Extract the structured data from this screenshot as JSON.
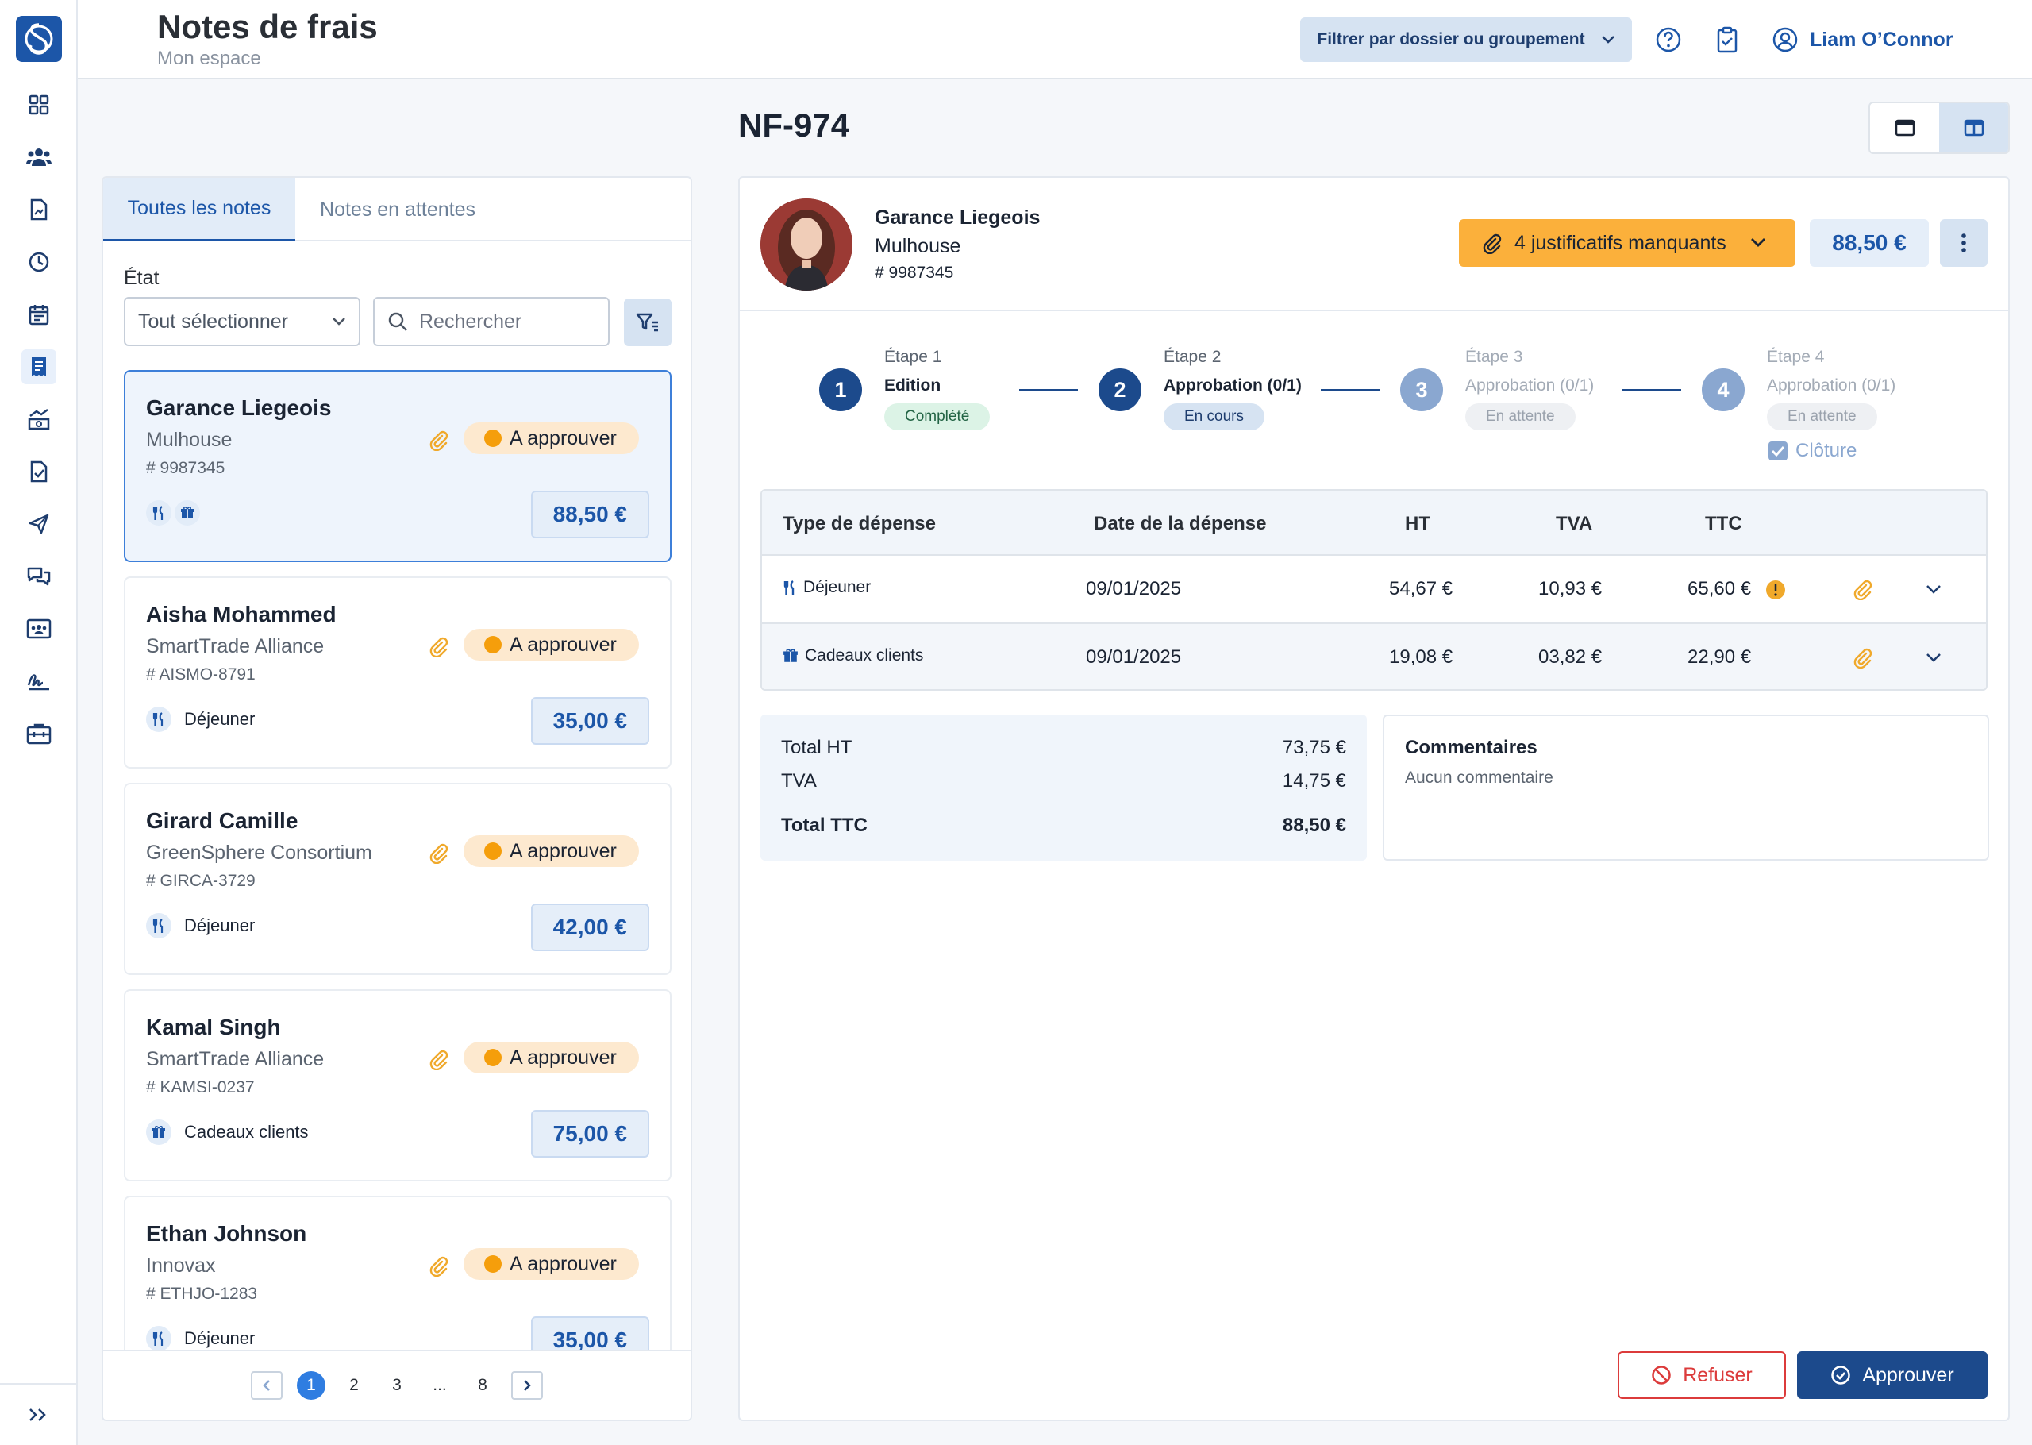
{
  "header": {
    "title": "Notes de frais",
    "subtitle": "Mon espace",
    "filter_label": "Filtrer par dossier ou groupement",
    "user_name": "Liam O’Connor"
  },
  "list": {
    "tabs": [
      "Toutes les notes",
      "Notes en attentes"
    ],
    "etat_label": "État",
    "select_value": "Tout sélectionner",
    "search_placeholder": "Rechercher",
    "cards": [
      {
        "name": "Garance Liegeois",
        "org": "Mulhouse",
        "id": "# 9987345",
        "status": "A approuver",
        "category": "",
        "amount": "88,50 €"
      },
      {
        "name": "Aisha Mohammed",
        "org": "SmartTrade Alliance",
        "id": "# AISMO-8791",
        "status": "A approuver",
        "category": "Déjeuner",
        "amount": "35,00 €"
      },
      {
        "name": "Girard Camille",
        "org": "GreenSphere Consortium",
        "id": "# GIRCA-3729",
        "status": "A approuver",
        "category": "Déjeuner",
        "amount": "42,00 €"
      },
      {
        "name": "Kamal Singh",
        "org": "SmartTrade Alliance",
        "id": "# KAMSI-0237",
        "status": "A approuver",
        "category": "Cadeaux clients",
        "amount": "75,00 €"
      },
      {
        "name": "Ethan Johnson",
        "org": "Innovax",
        "id": "# ETHJO-1283",
        "status": "A approuver",
        "category": "Déjeuner",
        "amount": "35,00 €"
      }
    ],
    "pagination": {
      "pages": [
        "1",
        "2",
        "3",
        "...",
        "8"
      ],
      "current": "1"
    }
  },
  "detail": {
    "ref": "NF-974",
    "person": {
      "name": "Garance Liegeois",
      "org": "Mulhouse",
      "id": "# 9987345"
    },
    "warning": "4 justificatifs manquants",
    "amount": "88,50 €",
    "steps": [
      {
        "num": "1",
        "label": "Étape 1",
        "name": "Edition",
        "status": "Complété"
      },
      {
        "num": "2",
        "label": "Étape 2",
        "name": "Approbation (0/1)",
        "status": "En cours"
      },
      {
        "num": "3",
        "label": "Étape 3",
        "name": "Approbation (0/1)",
        "status": "En attente"
      },
      {
        "num": "4",
        "label": "Étape 4",
        "name": "Approbation (0/1)",
        "status": "En attente"
      }
    ],
    "cloture": "Clôture",
    "table": {
      "headers": [
        "Type de dépense",
        "Date de la dépense",
        "HT",
        "TVA",
        "TTC"
      ],
      "rows": [
        {
          "type": "Déjeuner",
          "date": "09/01/2025",
          "ht": "54,67 €",
          "tva": "10,93 €",
          "ttc": "65,60 €"
        },
        {
          "type": "Cadeaux clients",
          "date": "09/01/2025",
          "ht": "19,08 €",
          "tva": "03,82 €",
          "ttc": "22,90 €"
        }
      ]
    },
    "totals": [
      {
        "label": "Total HT",
        "value": "73,75 €"
      },
      {
        "label": "TVA",
        "value": "14,75 €"
      },
      {
        "label": "Total TTC",
        "value": "88,50 €"
      }
    ],
    "comments_title": "Commentaires",
    "comments_text": "Aucun commentaire",
    "refuse_label": "Refuser",
    "approve_label": "Approuver"
  },
  "colors": {
    "primary": "#1c56a8",
    "dark_primary": "#1c4a8c",
    "warning": "#fbb03b",
    "danger": "#dc3b3b"
  }
}
